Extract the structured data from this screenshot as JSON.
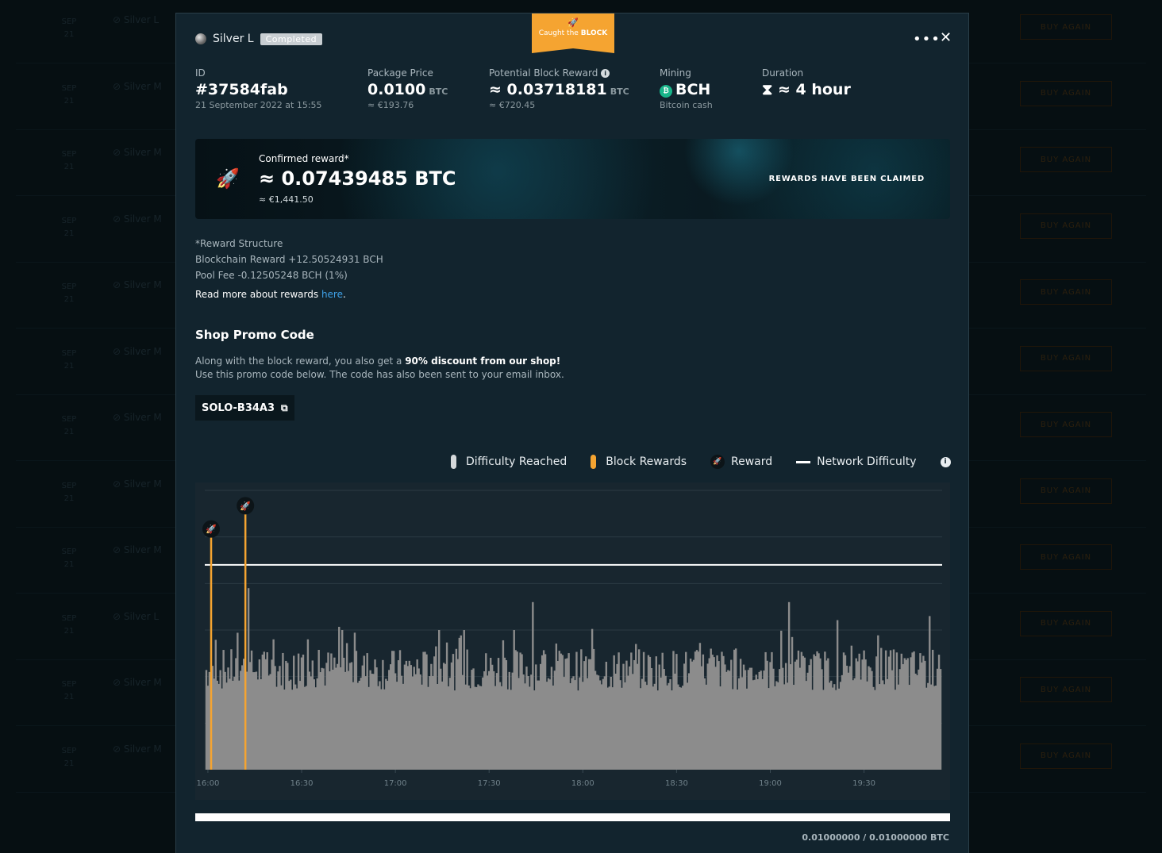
{
  "background": {
    "rows": [
      {
        "month": "SEP",
        "day": "21",
        "name": "Silver L",
        "button": "BUY AGAIN"
      },
      {
        "month": "SEP",
        "day": "21",
        "name": "Silver M",
        "button": "BUY AGAIN"
      },
      {
        "month": "SEP",
        "day": "21",
        "name": "Silver M",
        "button": "BUY AGAIN"
      },
      {
        "month": "SEP",
        "day": "21",
        "name": "Silver M",
        "button": "BUY AGAIN"
      },
      {
        "month": "SEP",
        "day": "21",
        "name": "Silver M",
        "button": "BUY AGAIN"
      },
      {
        "month": "SEP",
        "day": "21",
        "name": "Silver M",
        "button": "BUY AGAIN"
      },
      {
        "month": "SEP",
        "day": "21",
        "name": "Silver M",
        "button": "BUY AGAIN"
      },
      {
        "month": "SEP",
        "day": "21",
        "name": "Silver M",
        "button": "BUY AGAIN"
      },
      {
        "month": "SEP",
        "day": "21",
        "name": "Silver M",
        "button": "BUY AGAIN"
      },
      {
        "month": "SEP",
        "day": "21",
        "name": "Silver L",
        "button": "BUY AGAIN"
      },
      {
        "month": "SEP",
        "day": "21",
        "name": "Silver M",
        "button": "BUY AGAIN"
      },
      {
        "month": "SEP",
        "day": "21",
        "name": "Silver M",
        "button": "BUY AGAIN"
      }
    ]
  },
  "ribbon": {
    "prefix": "Caught the",
    "highlight": "BLOCK"
  },
  "header": {
    "package_name": "Silver L",
    "status": "Completed"
  },
  "stats": {
    "id": {
      "label": "ID",
      "value": "#37584fab",
      "sub": "21 September 2022 at 15:55"
    },
    "price": {
      "label": "Package Price",
      "value": "0.0100",
      "unit": "BTC",
      "sub": "≈ €193.76"
    },
    "potential": {
      "label": "Potential Block Reward",
      "value": "≈ 0.03718181",
      "unit": "BTC",
      "sub": "≈ €720.45"
    },
    "mining": {
      "label": "Mining",
      "value": "BCH",
      "sub": "Bitcoin cash"
    },
    "duration": {
      "label": "Duration",
      "value": "≈ 4 hour"
    }
  },
  "banner": {
    "label": "Confirmed reward*",
    "value": "≈ 0.07439485 BTC",
    "eur": "≈ €1,441.50",
    "claimed": "REWARDS HAVE BEEN CLAIMED"
  },
  "reward_structure": {
    "title": "*Reward Structure",
    "blockchain": "Blockchain Reward +12.50524931 BCH",
    "fee": "Pool Fee -0.12505248 BCH (1%)",
    "read_more": "Read more about rewards ",
    "link": "here",
    "period": "."
  },
  "promo": {
    "title": "Shop Promo Code",
    "text_pre": "Along with the block reward, you also get a ",
    "text_bold": "90% discount from our shop!",
    "text_post": " Use this promo code below. The code has also been sent to your email inbox.",
    "code": "SOLO-B34A3"
  },
  "legend": {
    "difficulty": "Difficulty Reached",
    "block_rewards": "Block Rewards",
    "reward": "Reward",
    "network": "Network Difficulty"
  },
  "colors": {
    "accent": "#f5a431",
    "difficulty_bar": "#8c8c8c",
    "legend_difficulty": "#d5d9db",
    "network_line": "#ffffff",
    "link": "#3ea1e8",
    "bch": "#19b58a"
  },
  "chart_data": {
    "type": "bar",
    "x_ticks": [
      "16:00",
      "16:30",
      "17:00",
      "17:30",
      "18:00",
      "18:30",
      "19:00",
      "19:30"
    ],
    "x_range": [
      "15:59",
      "19:55"
    ],
    "y_range": [
      0,
      6
    ],
    "network_difficulty": 4.4,
    "block_reward_times": [
      "15:59",
      "16:12"
    ],
    "difficulty_baseline": 1.7,
    "difficulty_spikes": [
      {
        "t": "16:13",
        "v": 3.9
      },
      {
        "t": "16:21",
        "v": 2.8
      },
      {
        "t": "16:32",
        "v": 2.8
      },
      {
        "t": "16:43",
        "v": 3.0
      },
      {
        "t": "17:14",
        "v": 3.0
      },
      {
        "t": "17:22",
        "v": 3.0
      },
      {
        "t": "17:38",
        "v": 3.0
      },
      {
        "t": "17:44",
        "v": 3.6
      },
      {
        "t": "18:17",
        "v": 2.7
      },
      {
        "t": "18:41",
        "v": 2.6
      },
      {
        "t": "19:06",
        "v": 3.6
      },
      {
        "t": "19:51",
        "v": 3.3
      }
    ]
  },
  "progress": {
    "value": 1.0,
    "text": "0.01000000 / 0.01000000 BTC"
  }
}
